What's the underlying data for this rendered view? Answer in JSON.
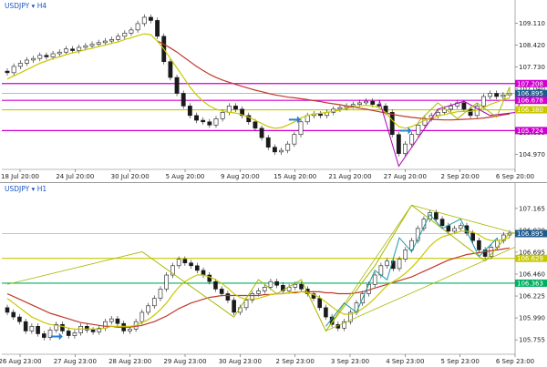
{
  "colors": {
    "background": "#ffffff",
    "candle": "#1a1a1a",
    "ma_fast": "#c8c800",
    "ma_slow": "#c0392b",
    "magenta": "#d000d0",
    "olive": "#c8c800",
    "green": "#00b060",
    "blue_line": "#5aa0c8",
    "price_tag": "#1f5a8c",
    "blue_arrow": "#2a7fd4",
    "pattern_magenta": "#b000b0",
    "pattern_cyan": "#1a9aa0",
    "pattern_olive": "#a8b800"
  },
  "chart_data": [
    {
      "type": "candlestick",
      "title": "USDJPY ▾ H4",
      "ylim": [
        104.5,
        109.5
      ],
      "y_ticks": [
        109.11,
        108.42,
        107.73,
        107.04,
        106.35,
        105.66,
        104.97
      ],
      "y_tick_labels": [
        "109.110",
        "108.420",
        "107.730",
        "107.040",
        "106.350",
        "105.660",
        "104.970"
      ],
      "x_tick_labels": [
        "18 Jul 20:00",
        "24 Jul 20:00",
        "30 Jul 20:00",
        "5 Aug 20:00",
        "9 Aug 20:00",
        "15 Aug 20:00",
        "21 Aug 20:00",
        "27 Aug 20:00",
        "2 Sep 20:00",
        "6 Sep 20:00"
      ],
      "price_tags": [
        {
          "label": "107.208",
          "value": 107.208,
          "color": "magenta"
        },
        {
          "label": "106.895",
          "value": 106.895,
          "color": "price_tag"
        },
        {
          "label": "106.678",
          "value": 106.678,
          "color": "magenta"
        },
        {
          "label": "106.380",
          "value": 106.38,
          "color": "olive"
        },
        {
          "label": "105.724",
          "value": 105.724,
          "color": "magenta"
        }
      ],
      "hlines": [
        {
          "value": 107.208,
          "color": "magenta"
        },
        {
          "value": 106.678,
          "color": "magenta"
        },
        {
          "value": 106.38,
          "color": "olive"
        },
        {
          "value": 105.724,
          "color": "magenta"
        },
        {
          "value": 106.895,
          "color": "blue_line"
        }
      ],
      "close": [
        107.55,
        107.75,
        107.85,
        107.95,
        108.0,
        108.1,
        108.05,
        108.15,
        108.2,
        108.3,
        108.25,
        108.35,
        108.4,
        108.45,
        108.5,
        108.55,
        108.6,
        108.7,
        108.8,
        108.9,
        109.1,
        109.3,
        109.2,
        108.7,
        107.9,
        107.4,
        106.9,
        106.5,
        106.2,
        106.05,
        106.0,
        105.9,
        106.1,
        106.3,
        106.5,
        106.4,
        106.2,
        106.0,
        105.8,
        105.5,
        105.2,
        105.05,
        105.1,
        105.3,
        105.6,
        106.0,
        106.2,
        106.25,
        106.2,
        106.3,
        106.4,
        106.45,
        106.5,
        106.55,
        106.6,
        106.65,
        106.55,
        106.5,
        106.3,
        105.6,
        105.0,
        105.3,
        105.6,
        105.9,
        106.1,
        106.2,
        106.3,
        106.4,
        106.5,
        106.6,
        106.4,
        106.2,
        106.5,
        106.8,
        106.9,
        106.8,
        106.85,
        106.9
      ],
      "ma_fast": [
        107.35,
        107.45,
        107.55,
        107.65,
        107.75,
        107.85,
        107.92,
        108.0,
        108.05,
        108.12,
        108.18,
        108.22,
        108.28,
        108.32,
        108.38,
        108.42,
        108.48,
        108.52,
        108.6,
        108.65,
        108.72,
        108.78,
        108.75,
        108.55,
        108.3,
        108.0,
        107.7,
        107.4,
        107.1,
        106.85,
        106.65,
        106.5,
        106.4,
        106.35,
        106.3,
        106.28,
        106.22,
        106.15,
        106.05,
        105.95,
        105.85,
        105.8,
        105.82,
        105.9,
        106.0,
        106.12,
        106.2,
        106.25,
        106.27,
        106.3,
        106.33,
        106.37,
        106.42,
        106.46,
        106.5,
        106.52,
        106.5,
        106.45,
        106.3,
        106.05,
        105.85,
        105.8,
        105.85,
        105.95,
        106.05,
        106.12,
        106.18,
        106.23,
        106.28,
        106.32,
        106.33,
        106.33,
        106.37,
        106.45,
        106.55,
        106.62,
        106.7,
        106.75
      ],
      "ma_slow": [
        null,
        null,
        null,
        null,
        null,
        null,
        null,
        null,
        null,
        null,
        null,
        null,
        null,
        null,
        null,
        null,
        null,
        null,
        null,
        null,
        null,
        null,
        null,
        108.55,
        108.45,
        108.33,
        108.2,
        108.05,
        107.9,
        107.75,
        107.62,
        107.5,
        107.4,
        107.32,
        107.25,
        107.18,
        107.12,
        107.06,
        107.0,
        106.95,
        106.9,
        106.85,
        106.82,
        106.78,
        106.76,
        106.73,
        106.7,
        106.67,
        106.64,
        106.6,
        106.57,
        106.54,
        106.5,
        106.47,
        106.43,
        106.4,
        106.36,
        106.32,
        106.28,
        106.24,
        106.2,
        106.17,
        106.14,
        106.12,
        106.1,
        106.08,
        106.07,
        106.06,
        106.06,
        106.07,
        106.08,
        106.09,
        106.1,
        106.12,
        106.15,
        106.18,
        106.22,
        106.25
      ]
    },
    {
      "type": "candlestick",
      "title": "USDJPY ▾ H1",
      "ylim": [
        105.6,
        107.32
      ],
      "y_ticks": [
        107.165,
        106.93,
        106.695,
        106.46,
        106.225,
        105.99,
        105.755
      ],
      "y_tick_labels": [
        "107.165",
        "106.930",
        "106.695",
        "106.460",
        "106.225",
        "105.990",
        "105.755"
      ],
      "x_tick_labels": [
        "26 Aug 23:00",
        "27 Aug 23:00",
        "28 Aug 23:00",
        "29 Aug 23:00",
        "30 Aug 23:00",
        "2 Sep 23:00",
        "3 Sep 23:00",
        "4 Sep 23:00",
        "5 Sep 23:00",
        "6 Sep 23:00"
      ],
      "price_tags": [
        {
          "label": "106.895",
          "value": 106.895,
          "color": "price_tag"
        },
        {
          "label": "106.629",
          "value": 106.629,
          "color": "olive"
        },
        {
          "label": "106.363",
          "value": 106.363,
          "color": "green"
        }
      ],
      "hlines": [
        {
          "value": 106.895,
          "color": "blue_line"
        },
        {
          "value": 106.629,
          "color": "olive"
        },
        {
          "value": 106.363,
          "color": "green"
        }
      ],
      "close": [
        106.05,
        106.0,
        105.95,
        105.85,
        105.9,
        105.82,
        105.78,
        105.86,
        105.92,
        105.85,
        105.8,
        105.83,
        105.9,
        105.86,
        105.84,
        105.88,
        105.95,
        105.98,
        105.93,
        105.85,
        105.87,
        105.95,
        106.05,
        106.12,
        106.2,
        106.3,
        106.45,
        106.55,
        106.62,
        106.58,
        106.55,
        106.5,
        106.45,
        106.38,
        106.3,
        106.25,
        106.18,
        106.05,
        106.1,
        106.18,
        106.25,
        106.28,
        106.32,
        106.38,
        106.34,
        106.28,
        106.32,
        106.35,
        106.3,
        106.25,
        106.2,
        106.1,
        106.0,
        105.92,
        105.88,
        105.95,
        106.05,
        106.15,
        106.25,
        106.35,
        106.45,
        106.55,
        106.6,
        106.52,
        106.62,
        106.72,
        106.82,
        106.95,
        107.05,
        107.12,
        107.05,
        106.98,
        106.92,
        106.95,
        106.98,
        106.9,
        106.82,
        106.72,
        106.65,
        106.75,
        106.82,
        106.88,
        106.9
      ],
      "ma_fast": [
        106.2,
        106.15,
        106.1,
        106.05,
        106.0,
        105.97,
        105.94,
        105.92,
        105.91,
        105.9,
        105.88,
        105.87,
        105.87,
        105.87,
        105.87,
        105.87,
        105.88,
        105.9,
        105.9,
        105.9,
        105.9,
        105.91,
        105.94,
        105.97,
        106.02,
        106.08,
        106.15,
        106.24,
        106.32,
        106.38,
        106.42,
        106.45,
        106.45,
        106.43,
        106.4,
        106.36,
        106.31,
        106.25,
        106.21,
        106.19,
        106.19,
        106.2,
        106.22,
        106.24,
        106.25,
        106.25,
        106.26,
        106.27,
        106.27,
        106.26,
        106.24,
        106.21,
        106.16,
        106.11,
        106.06,
        106.03,
        106.03,
        106.05,
        106.09,
        106.14,
        106.2,
        106.27,
        106.34,
        106.38,
        106.42,
        106.47,
        106.53,
        106.6,
        106.68,
        106.76,
        106.82,
        106.86,
        106.88,
        106.9,
        106.92,
        106.92,
        106.91,
        106.88,
        106.84,
        106.82,
        106.82,
        106.83,
        106.85
      ],
      "ma_slow": [
        106.25,
        106.22,
        106.19,
        106.16,
        106.13,
        106.1,
        106.07,
        106.04,
        106.02,
        106.0,
        105.98,
        105.96,
        105.94,
        105.93,
        105.92,
        105.91,
        105.9,
        105.9,
        105.89,
        105.89,
        105.89,
        105.9,
        105.91,
        105.93,
        105.95,
        105.98,
        106.01,
        106.05,
        106.09,
        106.12,
        106.15,
        106.17,
        106.19,
        106.21,
        106.22,
        106.23,
        106.23,
        106.23,
        106.23,
        106.23,
        106.23,
        106.23,
        106.24,
        106.24,
        106.25,
        106.25,
        106.26,
        106.26,
        106.27,
        106.27,
        106.27,
        106.27,
        106.26,
        106.26,
        106.25,
        106.25,
        106.25,
        106.26,
        106.27,
        106.29,
        106.31,
        106.33,
        106.35,
        106.37,
        106.39,
        106.41,
        106.43,
        106.46,
        106.49,
        106.52,
        106.55,
        106.58,
        106.61,
        106.63,
        106.65,
        106.67,
        106.68,
        106.69,
        106.7,
        106.71,
        106.72,
        106.73,
        106.74
      ]
    }
  ]
}
